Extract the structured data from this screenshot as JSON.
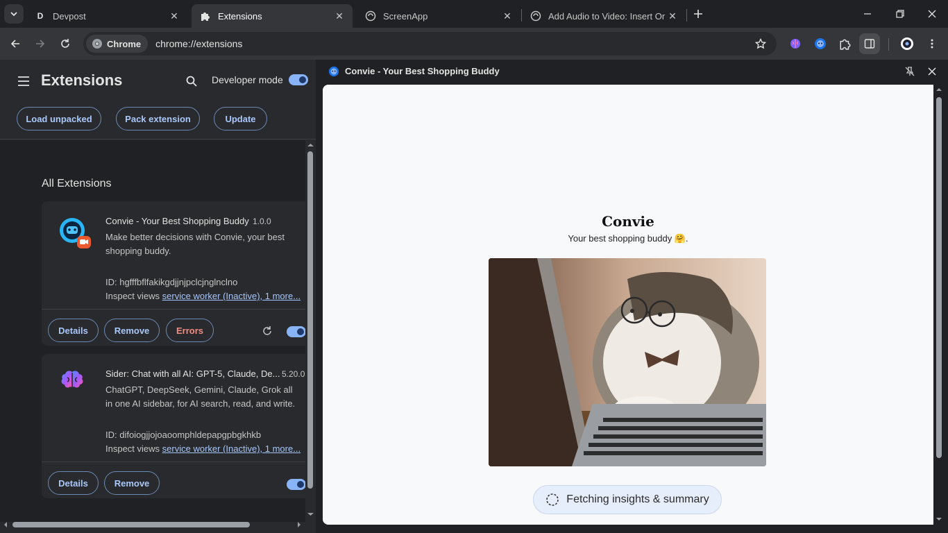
{
  "tabs": [
    {
      "title": "Devpost",
      "favicon_letter": "D",
      "active": false
    },
    {
      "title": "Extensions",
      "active": true
    },
    {
      "title": "ScreenApp",
      "active": false
    },
    {
      "title": "Add Audio to Video: Insert Or R",
      "active": false
    }
  ],
  "toolbar": {
    "chip_label": "Chrome",
    "url": "chrome://extensions"
  },
  "extensions_page": {
    "title": "Extensions",
    "developer_mode_label": "Developer mode",
    "developer_mode": true,
    "buttons": {
      "load_unpacked": "Load unpacked",
      "pack_extension": "Pack extension",
      "update": "Update"
    },
    "section_title": "All Extensions",
    "items": [
      {
        "name": "Convie - Your Best Shopping Buddy",
        "version": "1.0.0",
        "description": "Make better decisions with Convie, your best shopping buddy.",
        "id_line": "ID: hgfffbflfakikgdjjnjpclcjnglnclno",
        "inspect_label": "Inspect views",
        "inspect_link": "service worker (Inactive), 1 more...",
        "details": "Details",
        "remove": "Remove",
        "errors": "Errors",
        "enabled": true
      },
      {
        "name": "Sider: Chat with all AI: GPT-5, Claude, De...",
        "version": "5.20.0",
        "description": "ChatGPT, DeepSeek, Gemini, Claude, Grok all in one AI sidebar, for AI search, read, and write.",
        "id_line": "ID: difoiogjjojoaoomphldepapgpbgkhkb",
        "inspect_label": "Inspect views",
        "inspect_link": "service worker (Inactive), 1 more...",
        "details": "Details",
        "remove": "Remove",
        "enabled": true
      }
    ]
  },
  "side_panel": {
    "title": "Convie - Your Best Shopping Buddy",
    "heading": "Convie",
    "tagline": "Your best shopping buddy 🤗.",
    "fetch_button": "Fetching insights & summary"
  },
  "colors": {
    "accent": "#a8c7fa",
    "toggle_on": "#8ab4f8",
    "error": "#f28b82",
    "panel_bg": "#f8f9fa"
  }
}
